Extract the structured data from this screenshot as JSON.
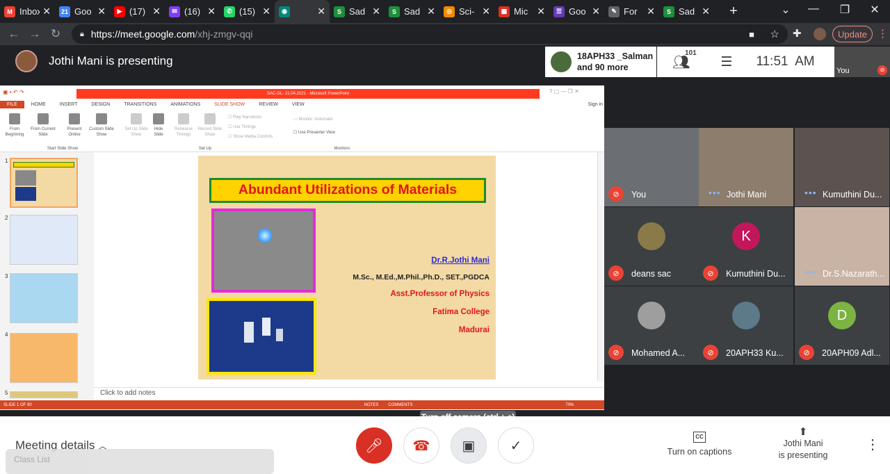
{
  "browser": {
    "tabs": [
      {
        "title": "Inbox",
        "favicon": "gmail-icon",
        "color": "#ea4335",
        "glyph": "M"
      },
      {
        "title": "Goo",
        "favicon": "calendar-icon",
        "color": "#4285f4",
        "glyph": "21"
      },
      {
        "title": "(17)",
        "favicon": "youtube-icon",
        "color": "#ff0000",
        "glyph": "▶"
      },
      {
        "title": "(16)",
        "favicon": "mail-icon",
        "color": "#7e3ff2",
        "glyph": "✉"
      },
      {
        "title": "(15)",
        "favicon": "whatsapp-icon",
        "color": "#25d366",
        "glyph": "✆"
      },
      {
        "title": "",
        "favicon": "meet-icon",
        "color": "#00897b",
        "glyph": "◉",
        "active": true
      },
      {
        "title": "Sad",
        "favicon": "sad-icon",
        "color": "#1e8e3e",
        "glyph": "S"
      },
      {
        "title": "Sad",
        "favicon": "sad-icon",
        "color": "#1e8e3e",
        "glyph": "S"
      },
      {
        "title": "Sci-",
        "favicon": "eye-icon",
        "color": "#f28b00",
        "glyph": "◎"
      },
      {
        "title": "Mic",
        "favicon": "microsoft-forms-icon",
        "color": "#d93025",
        "glyph": "▦"
      },
      {
        "title": "Goo",
        "favicon": "google-forms-icon",
        "color": "#673ab7",
        "glyph": "☰"
      },
      {
        "title": "For",
        "favicon": "pen-icon",
        "color": "#5f6368",
        "glyph": "✎"
      },
      {
        "title": "Sad",
        "favicon": "sad-icon",
        "color": "#1e8e3e",
        "glyph": "S"
      }
    ],
    "url_host": "https://meet.google.com",
    "url_path": "/xhj-zmgv-qqi",
    "update_label": "Update"
  },
  "meet": {
    "presenting_label": "Jothi Mani is presenting",
    "participants_card": {
      "line1": "18APH33 _Salman",
      "line2": "and 90 more"
    },
    "participant_count": "101",
    "time": "11:51  AM",
    "self_label": "You"
  },
  "ppt": {
    "window_title": "SAC-GL- 21.04.2021 - Microsoft PowerPoint",
    "menu": [
      "FILE",
      "HOME",
      "INSERT",
      "DESIGN",
      "TRANSITIONS",
      "ANIMATIONS",
      "SLIDE SHOW",
      "REVIEW",
      "VIEW"
    ],
    "sign_in": "Sign in",
    "ribbon": {
      "from_beginning": "From Beginning",
      "from_current": "From Current Slide",
      "present_online": "Present Online",
      "custom_show": "Custom Slide Show",
      "group_start": "Start Slide Show",
      "setup_show": "Set Up Slide Show",
      "hide_slide": "Hide Slide",
      "rehearse": "Rehearse Timings",
      "record": "Record Slide Show",
      "group_setup": "Set Up",
      "play_narrations": "Play Narrations",
      "use_timings": "Use Timings",
      "show_media": "Show Media Controls",
      "monitor": "Monitor: Automatic",
      "presenter_view": "Use Presenter View",
      "group_monitors": "Monitors"
    },
    "thumb_numbers": [
      "1",
      "2",
      "3",
      "4",
      "5"
    ],
    "slide": {
      "title": "Abundant Utilizations of Materials",
      "author": "Dr.R.Jothi Mani",
      "degrees": "M.Sc., M.Ed.,M.Phil.,Ph.D., SET.,PGDCA",
      "position": "Asst.Professor of Physics",
      "college": "Fatima College",
      "city": "Madurai"
    },
    "notes_placeholder": "Click to add notes",
    "status_left": "SLIDE 1 OF 90",
    "status_notes": "NOTES",
    "status_comments": "COMMENTS",
    "zoom": "70%"
  },
  "tiles": [
    {
      "name": "You",
      "type": "video",
      "muted": true,
      "bg": "#6b6e73"
    },
    {
      "name": "Jothi Mani",
      "type": "video",
      "muted": false,
      "bg": "#8c7d6d"
    },
    {
      "name": "Kumuthini Du...",
      "type": "video",
      "muted": false,
      "bg": "#5c5350"
    },
    {
      "name": "deans sac",
      "type": "avatar",
      "muted": true,
      "avatar_color": "#8a7a4a",
      "initial": ""
    },
    {
      "name": "Kumuthini Du...",
      "type": "avatar",
      "muted": true,
      "avatar_color": "#c2185b",
      "initial": "K"
    },
    {
      "name": "Dr.S.Nazarath...",
      "type": "video",
      "muted": false,
      "bg": "#c9b3a5"
    },
    {
      "name": "Mohamed A...",
      "type": "avatar",
      "muted": true,
      "avatar_color": "#9e9e9e",
      "initial": ""
    },
    {
      "name": "20APH33 Ku...",
      "type": "avatar",
      "muted": true,
      "avatar_color": "#5d7a8a",
      "initial": ""
    },
    {
      "name": "20APH09 Adl...",
      "type": "avatar",
      "muted": true,
      "avatar_color": "#7cb342",
      "initial": "D"
    }
  ],
  "bottom": {
    "meeting_details": "Meeting details",
    "tooltip": "Turn off camera (ctrl + e)",
    "captions": "Turn on captions",
    "presenting_line1": "Jothi Mani",
    "presenting_line2": "is presenting",
    "class_list": "Class List"
  }
}
